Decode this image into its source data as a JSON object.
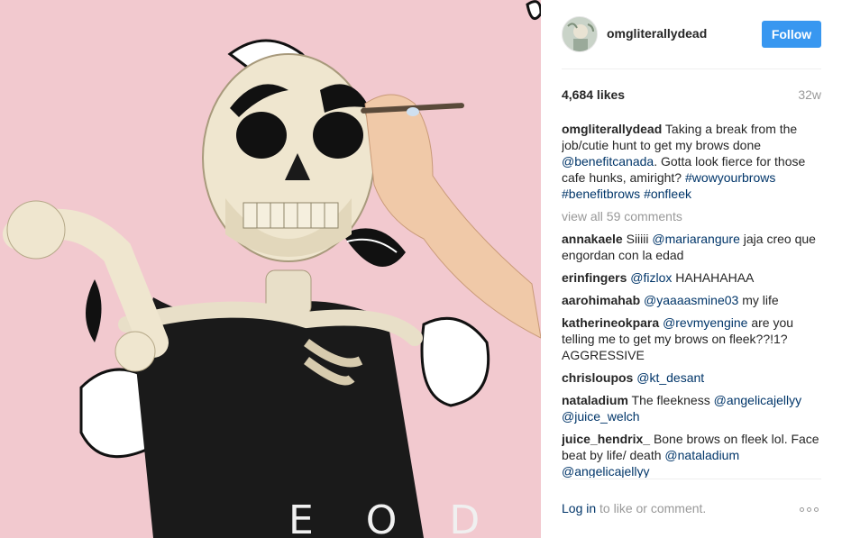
{
  "post": {
    "username": "omgliterallydead",
    "follow_label": "Follow",
    "likes": "4,684 likes",
    "age": "32w"
  },
  "caption": {
    "user": "omgliterallydead",
    "text_1": "Taking a break from the job/cutie hunt to get my brows done ",
    "mention_1": "@benefitcanada",
    "text_2": ". Gotta look fierce for those cafe hunks, amiright? ",
    "hashtag_1": "#wowyourbrows",
    "hashtag_2": "#benefitbrows",
    "hashtag_3": "#onfleek"
  },
  "view_all": "view all 59 comments",
  "comments": [
    {
      "user": "annakaele",
      "pre": "Siiiii ",
      "mention": "@mariarangure",
      "post": " jaja creo que engordan con la edad",
      "mention2": ""
    },
    {
      "user": "erinfingers",
      "pre": "",
      "mention": "@fizlox",
      "post": " HAHAHAHAA",
      "mention2": ""
    },
    {
      "user": "aarohimahab",
      "pre": "",
      "mention": "@yaaaasmine03",
      "post": " my life",
      "mention2": ""
    },
    {
      "user": "katherineokpara",
      "pre": "",
      "mention": "@revmyengine",
      "post": " are you telling me to get my brows on fleek??!1? AGGRESSIVE",
      "mention2": ""
    },
    {
      "user": "chrisloupos",
      "pre": "",
      "mention": "@kt_desant",
      "post": "",
      "mention2": ""
    },
    {
      "user": "nataladium",
      "pre": "The fleekness ",
      "mention": "@angelicajellyy",
      "post": " ",
      "mention2": "@juice_welch"
    },
    {
      "user": "juice_hendrix_",
      "pre": "Bone brows on fleek lol. Face beat by life/ death ",
      "mention": "@nataladium",
      "post": " ",
      "mention2": "@angelicajellyy"
    }
  ],
  "footer": {
    "login": "Log in",
    "text": " to like or comment."
  },
  "photo_text": "E O D",
  "colors": {
    "accent": "#3897f0",
    "link": "#003569",
    "muted": "#999999",
    "background_pink": "#f2c9cf"
  }
}
